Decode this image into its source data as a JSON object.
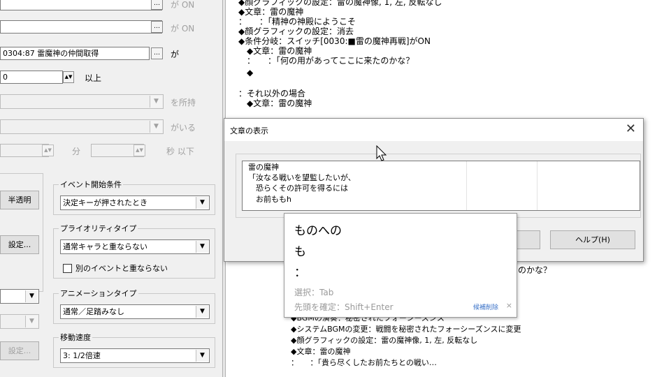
{
  "left_panel": {
    "row1": {
      "text": "",
      "btn": "…",
      "label": "が ON"
    },
    "row2": {
      "text": "",
      "btn": "…",
      "label": "が ON"
    },
    "row3": {
      "text": "0304:87  雷魔神の仲間取得",
      "btn": "…",
      "label": "が"
    },
    "row4": {
      "text": "0",
      "spin": "▲▼",
      "label": "以上"
    },
    "row5": {
      "arrow": "▼",
      "label": "を所持"
    },
    "row6": {
      "arrow": "▼",
      "label": "がいる"
    },
    "row7": {
      "spin1": "▲▼",
      "unit1": "分",
      "spin2": "▲▼",
      "unit2": "秒 以下"
    },
    "btn_semitransparent": "半透明",
    "btn_settings": "設定...",
    "btn_disabled": "設定...",
    "event_start": {
      "title": "イベント開始条件",
      "value": "決定キーが押されたとき"
    },
    "priority": {
      "title": "プライオリティタイプ",
      "value": "通常キャラと重ならない",
      "checkbox_label": "別のイベントと重ならない",
      "checked": false
    },
    "animation": {
      "title": "アニメーションタイプ",
      "value": "通常／足踏みなし"
    },
    "speed": {
      "title": "移動速度",
      "value": "3: 1/2倍速"
    }
  },
  "event_list": {
    "top_lines": [
      "◆顔グラフィックの設定：雷の魔神像, 1, 左, 反転なし",
      "◆文章：雷の魔神",
      "：　　：「精神の神殿にようこそ",
      "◆顔グラフィックの設定：消去",
      "◆条件分岐：スイッチ[0030:■雷の魔神再戦]がON",
      "　◆文章：雷の魔神",
      "　：　　：「何の用があってここに来たのかな？",
      "　◆",
      "：それ以外の場合",
      "　◆文章：雷の魔神"
    ],
    "mid_line": "のかな？",
    "bottom_lines": [
      "　◆BGMの演奏：秘密されたフォーシーズンス",
      "　◆システムBGMの変更：戦闘を秘密されたフォーシーズンスに変更",
      "　◆顔グラフィックの設定：雷の魔神像, 1, 左, 反転なし",
      "　◆文章：雷の魔神",
      "　：　　：「貴ら尽くしたお前たちとの戦い…"
    ]
  },
  "dialog": {
    "title": "文章の表示",
    "close": "✕",
    "text_lines": [
      "雷の魔神",
      "「汝なる戦いを望監したいが、",
      "　恐らくその許可を得るには",
      "　お前ももh"
    ],
    "help_button": "ヘルプ(H)"
  },
  "ime": {
    "candidates": [
      "ものへの",
      "も",
      "："
    ],
    "hint_select": "選択：Tab",
    "hint_confirm": "先頭を確定：Shift+Enter",
    "link": "候補削除",
    "close": "×"
  }
}
